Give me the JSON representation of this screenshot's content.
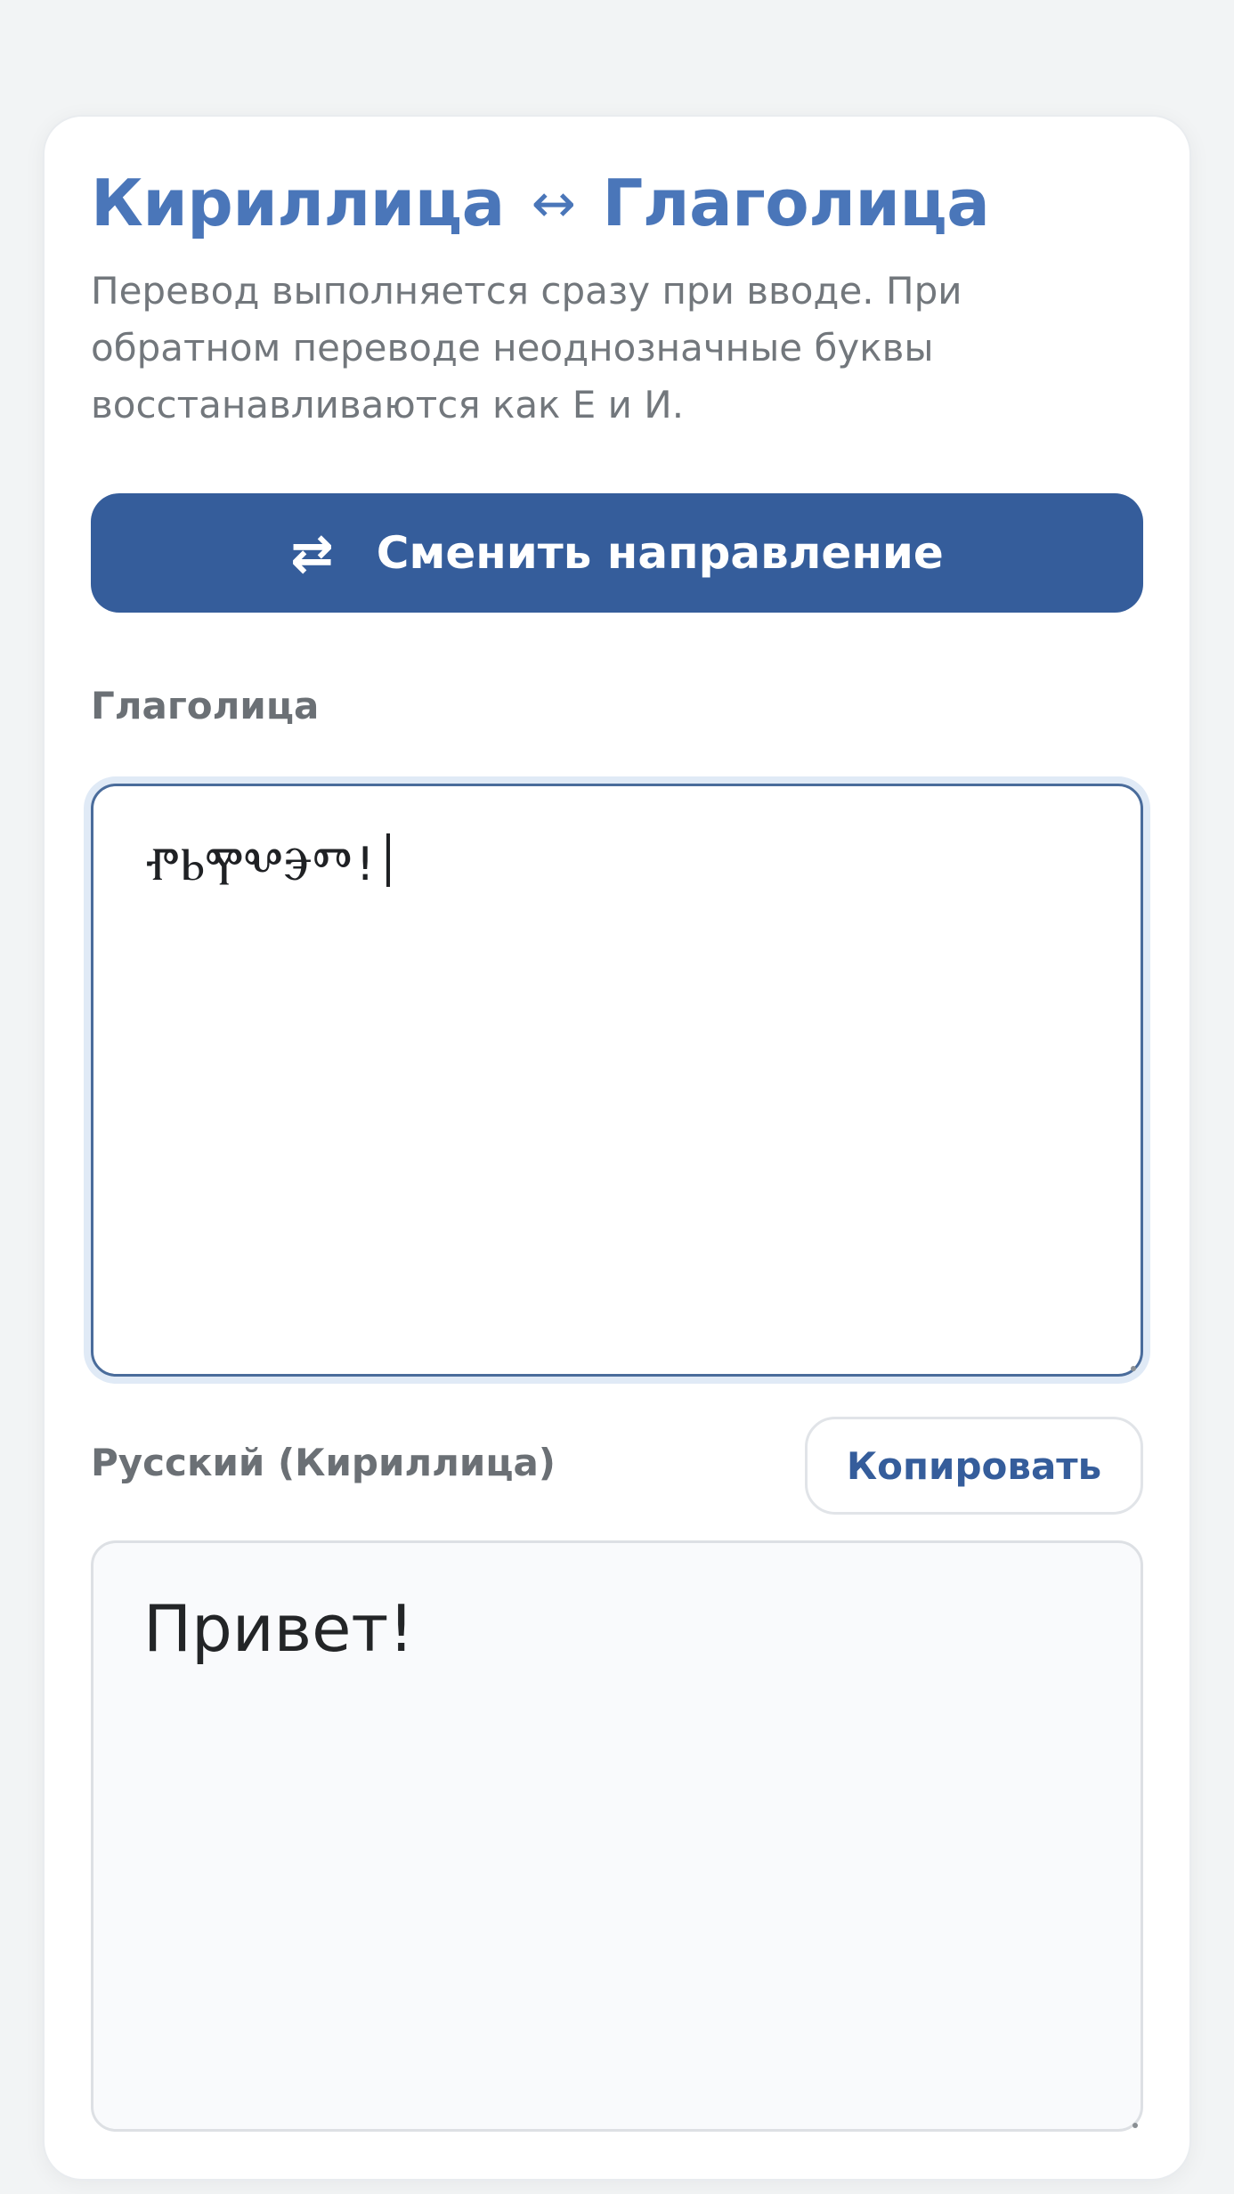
{
  "header": {
    "title_left": "Кириллица",
    "title_arrow": "↔",
    "title_right": "Глаголица",
    "description": "Перевод выполняется сразу при вводе. При обратном переводе неоднозначные буквы восстанавливаются как Е и И."
  },
  "swap_button": {
    "icon": "⇄",
    "label": "Сменить направление"
  },
  "source": {
    "label": "Глаголица",
    "value": "ⰒⰓⰉⰂⰅⰕ!"
  },
  "target": {
    "label": "Русский (Кириллица)",
    "copy_label": "Копировать",
    "value": "Привет!"
  },
  "colors": {
    "accent": "#4a76b9",
    "button": "#355d9b",
    "muted_text": "#72777c",
    "page_bg": "#f2f4f5"
  }
}
